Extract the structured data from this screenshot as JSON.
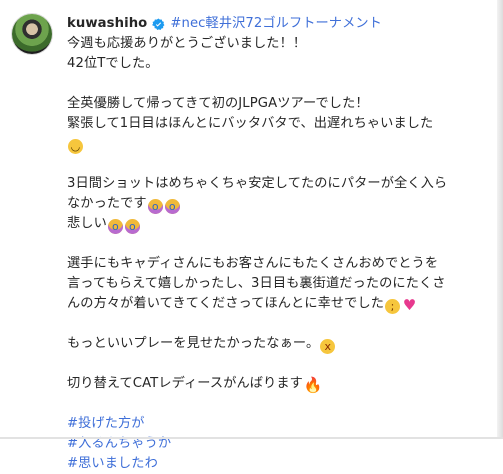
{
  "post": {
    "username": "kuwashiho",
    "location_tag": "#nec軽井沢72ゴルフトーナメント",
    "caption_lines": {
      "l1": "今週も応援ありがとうございました！！",
      "l2": "42位Tでした。",
      "l3": "全英優勝して帰ってきて初のJLPGAツアーでした！",
      "l4": "緊張して1日目はほんとにバッタバタで、出遅れちゃいました",
      "l6": "3日間ショットはめちゃくちゃ安定してたのにパターが全く入ら",
      "l7": "なかったです",
      "l8": "悲しい",
      "l9": "選手にもキャディさんにもお客さんにもたくさんおめでとうを",
      "l10": "言ってもらえて嬉しかったし、3日目も裏街道だったのにたくさ",
      "l11": "んの方々が着いてきてくださってほんとに幸せでした",
      "l12": "もっといいプレーを見せたかったなぁー。",
      "l13": "切り替えてCATレディースがんばります"
    },
    "hashtags": [
      "#投げた方が",
      "#入るんちゃうか",
      "#思いましたわ"
    ],
    "colors": {
      "text": "#262626",
      "link": "#3f6fd8",
      "verified": "#1d9bf0"
    },
    "icons": {
      "verified": "verified-badge-icon",
      "emojis": [
        "sweat-smile-emoji",
        "crying-face-emoji",
        "heart-emoji",
        "dizzy-face-emoji",
        "fire-emoji"
      ]
    }
  }
}
